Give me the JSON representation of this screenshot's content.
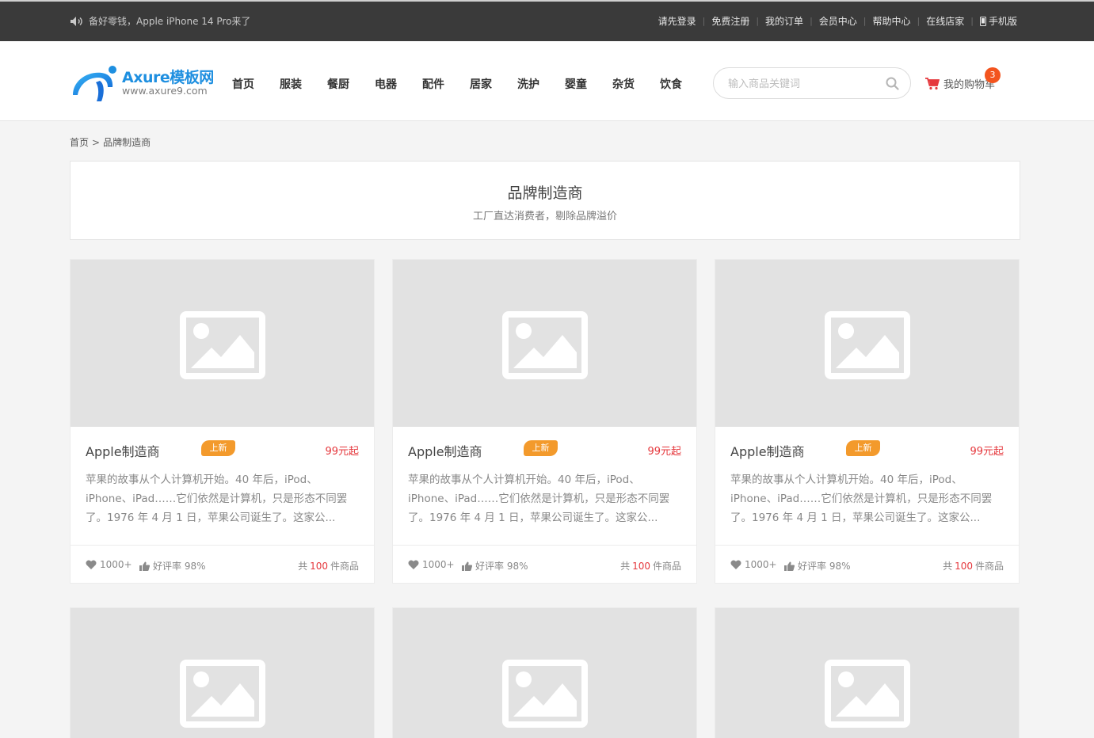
{
  "topbar": {
    "notice": "备好零钱，Apple iPhone 14 Pro来了",
    "links": [
      "请先登录",
      "免费注册",
      "我的订单",
      "会员中心",
      "帮助中心",
      "在线店家"
    ],
    "mobile": "手机版"
  },
  "header": {
    "logo_brand": "Axure模板网",
    "logo_url": "www.axure9.com",
    "nav": [
      "首页",
      "服装",
      "餐厨",
      "电器",
      "配件",
      "居家",
      "洗护",
      "婴童",
      "杂货",
      "饮食"
    ],
    "search_placeholder": "输入商品关键词",
    "cart_label": "我的购物车",
    "cart_count": "3"
  },
  "breadcrumb": {
    "home": "首页",
    "sep": ">",
    "current": "品牌制造商"
  },
  "title": {
    "heading": "品牌制造商",
    "subtitle": "工厂直达消费者，剔除品牌溢价"
  },
  "cards": [
    {
      "name": "Apple制造商",
      "tag": "上新",
      "price": "99元起",
      "desc": "苹果的故事从个人计算机开始。40 年后，iPod、iPhone、iPad……它们依然是计算机，只是形态不同罢了。1976 年 4 月 1 日，苹果公司诞生了。这家公...",
      "likes": "1000+",
      "rating": "好评率 98%",
      "total_prefix": "共",
      "total_count": "100",
      "total_suffix": "件商品"
    },
    {
      "name": "Apple制造商",
      "tag": "上新",
      "price": "99元起",
      "desc": "苹果的故事从个人计算机开始。40 年后，iPod、iPhone、iPad……它们依然是计算机，只是形态不同罢了。1976 年 4 月 1 日，苹果公司诞生了。这家公...",
      "likes": "1000+",
      "rating": "好评率 98%",
      "total_prefix": "共",
      "total_count": "100",
      "total_suffix": "件商品"
    },
    {
      "name": "Apple制造商",
      "tag": "上新",
      "price": "99元起",
      "desc": "苹果的故事从个人计算机开始。40 年后，iPod、iPhone、iPad……它们依然是计算机，只是形态不同罢了。1976 年 4 月 1 日，苹果公司诞生了。这家公...",
      "likes": "1000+",
      "rating": "好评率 98%",
      "total_prefix": "共",
      "total_count": "100",
      "total_suffix": "件商品"
    },
    {
      "name": "",
      "tag": "",
      "price": "",
      "desc": "",
      "likes": "",
      "rating": "",
      "total_prefix": "",
      "total_count": "",
      "total_suffix": ""
    },
    {
      "name": "",
      "tag": "",
      "price": "",
      "desc": "",
      "likes": "",
      "rating": "",
      "total_prefix": "",
      "total_count": "",
      "total_suffix": ""
    },
    {
      "name": "",
      "tag": "",
      "price": "",
      "desc": "",
      "likes": "",
      "rating": "",
      "total_prefix": "",
      "total_count": "",
      "total_suffix": ""
    }
  ],
  "colors": {
    "accent_red": "#e5373c",
    "tag_orange": "#f39a2c",
    "logo_blue": "#1e8fe0",
    "badge": "#f3541e"
  }
}
